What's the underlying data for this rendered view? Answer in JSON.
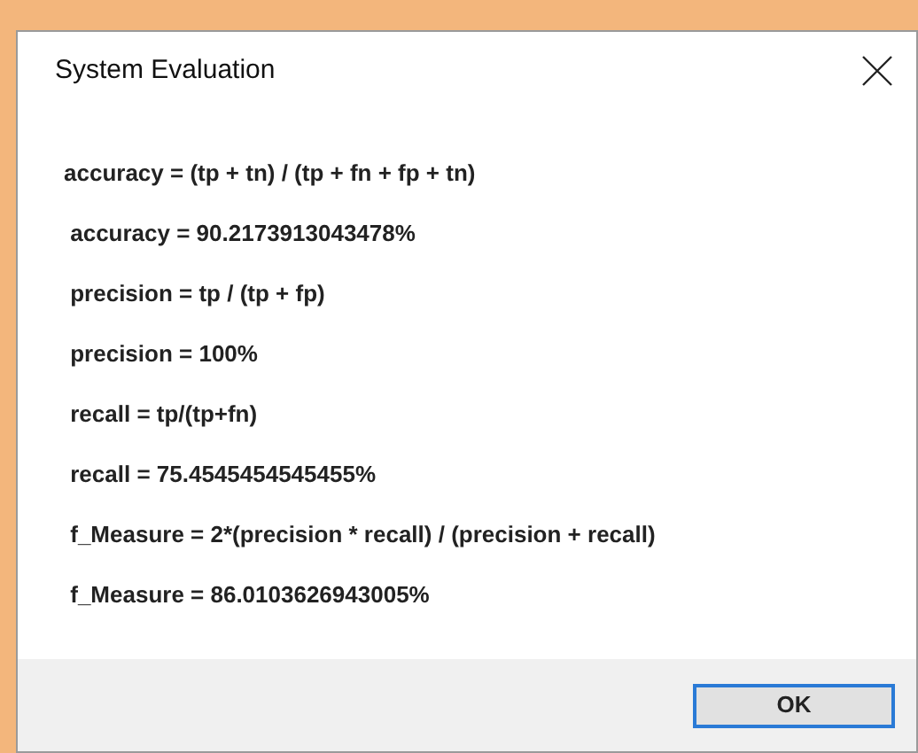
{
  "window": {
    "title": "System Evaluation"
  },
  "lines": [
    "accuracy = (tp + tn) / (tp + fn + fp + tn)",
    " accuracy = 90.2173913043478%",
    " precision = tp / (tp + fp)",
    " precision = 100%",
    " recall = tp/(tp+fn)",
    " recall = 75.4545454545455%",
    " f_Measure = 2*(precision * recall) / (precision + recall)",
    " f_Measure = 86.0103626943005%"
  ],
  "buttons": [
    "OK"
  ]
}
